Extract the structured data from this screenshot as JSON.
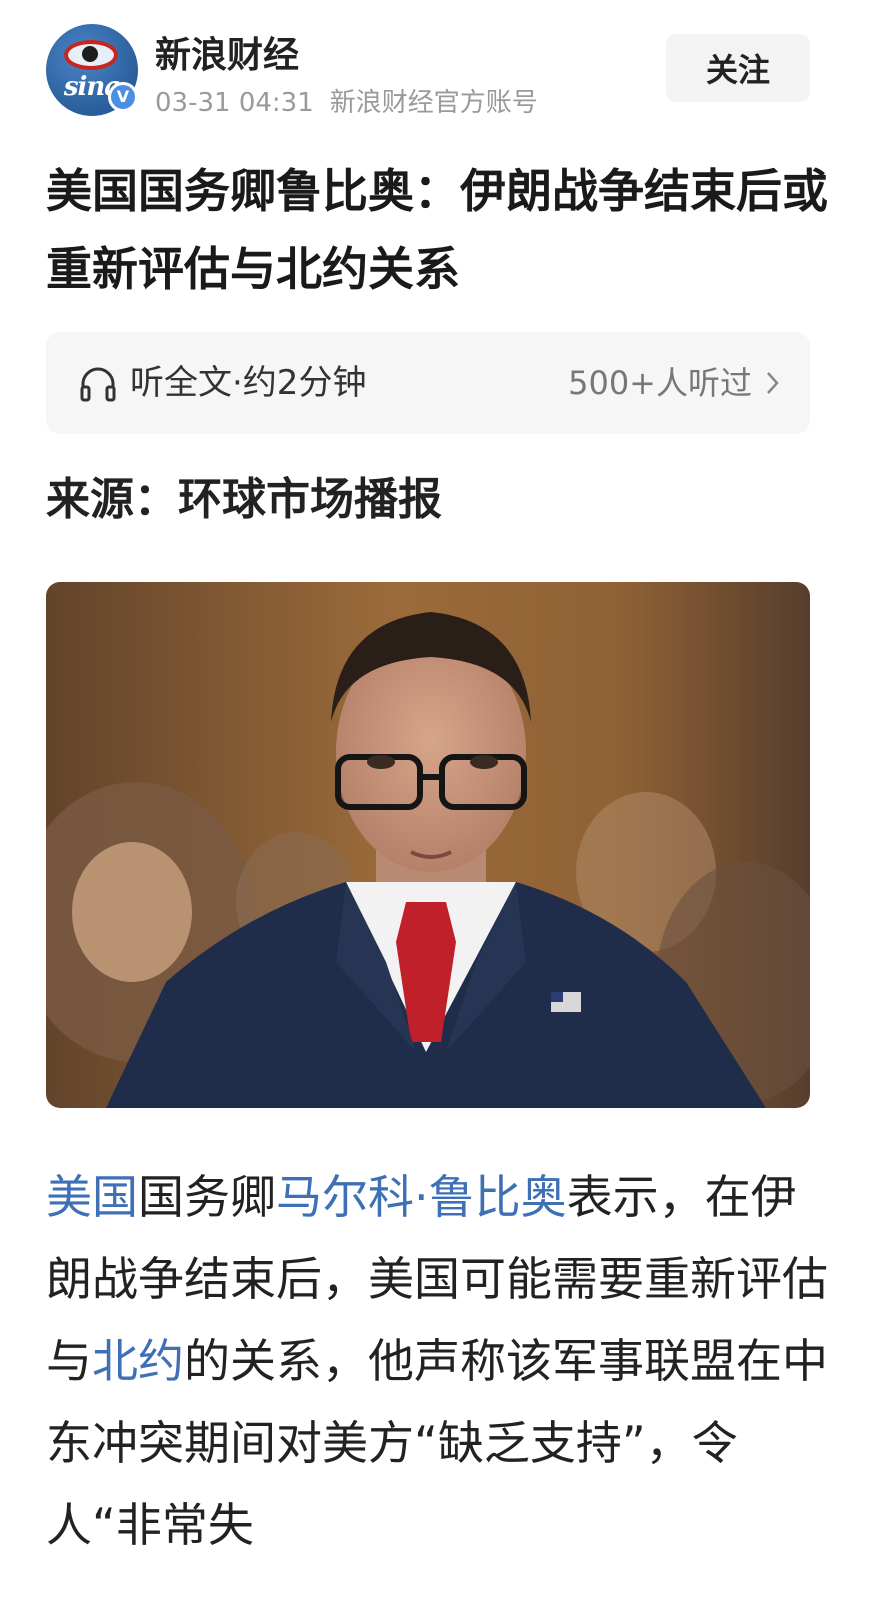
{
  "header": {
    "avatar_logo_text": "sina",
    "verified_badge": "V",
    "account_name": "新浪财经",
    "time": "03-31 04:31",
    "account_desc": "新浪财经官方账号",
    "follow_label": "关注"
  },
  "article": {
    "title": "美国国务卿鲁比奥：伊朗战争结束后或重新评估与北约关系",
    "listen": {
      "label": "听全文·约2分钟",
      "count": "500+人听过",
      "icon": "headphones-icon"
    },
    "source": "来源：环球市场播报",
    "body": [
      {
        "text": "美国",
        "link": true
      },
      {
        "text": "国务卿",
        "link": false
      },
      {
        "text": "马尔科·鲁比奥",
        "link": true
      },
      {
        "text": "表示，在伊朗战争结束后，美国可能需要重新评估与",
        "link": false
      },
      {
        "text": "北约",
        "link": true
      },
      {
        "text": "的关系，他声称该军事联盟在中东冲突期间对美方“缺乏支持”，令人“非常失",
        "link": false
      }
    ]
  },
  "colors": {
    "link": "#3f6fb6",
    "meta_gray": "#9a9a9a",
    "panel_bg": "#f6f6f6",
    "tie_red": "#c0202a",
    "suit_navy": "#1f2d4a"
  }
}
